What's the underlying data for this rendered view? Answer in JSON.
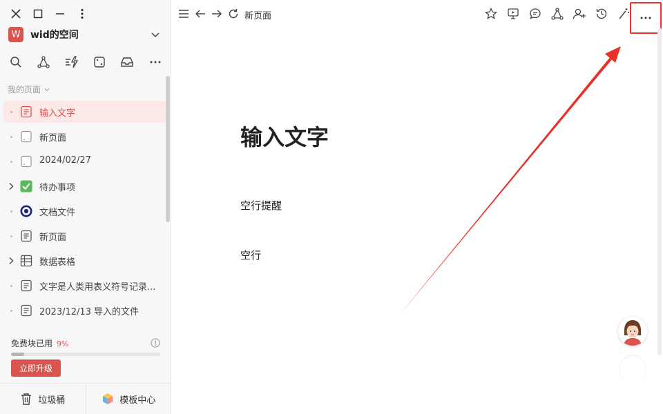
{
  "workspace": {
    "avatar_letter": "W",
    "name": "wid的空间"
  },
  "sidebar": {
    "section_label": "我的页面",
    "pages": [
      {
        "label": "输入文字",
        "icon": "doc-lines-icon",
        "lead": "dot",
        "active": true
      },
      {
        "label": "新页面",
        "icon": "blank-page-icon",
        "lead": "dot",
        "active": false
      },
      {
        "label": "2024/02/27",
        "icon": "blank-page-icon",
        "lead": "dot",
        "active": false
      },
      {
        "label": "待办事项",
        "icon": "check-box-icon",
        "lead": "chevron",
        "active": false
      },
      {
        "label": "文档文件",
        "icon": "eye-circle-icon",
        "lead": "dot",
        "active": false
      },
      {
        "label": "新页面",
        "icon": "doc-lines-icon",
        "lead": "dot",
        "active": false
      },
      {
        "label": "数据表格",
        "icon": "table-icon",
        "lead": "chevron",
        "active": false
      },
      {
        "label": "文字是人类用表义符号记录...",
        "icon": "doc-lines-icon",
        "lead": "dot",
        "active": false
      },
      {
        "label": "2023/12/13 导入的文件",
        "icon": "doc-lines-icon",
        "lead": "dot",
        "active": false
      }
    ],
    "quota": {
      "label": "免费块已用",
      "percent_text": "9%",
      "percent": 9
    },
    "upgrade_label": "立即升级",
    "footer": {
      "trash_label": "垃圾桶",
      "templates_label": "模板中心"
    }
  },
  "topbar": {
    "title": "新页面"
  },
  "document": {
    "title": "输入文字",
    "paragraphs": [
      "空行提醒",
      "空行"
    ]
  },
  "colors": {
    "accent": "#d9534f",
    "highlight": "#e8312a"
  }
}
